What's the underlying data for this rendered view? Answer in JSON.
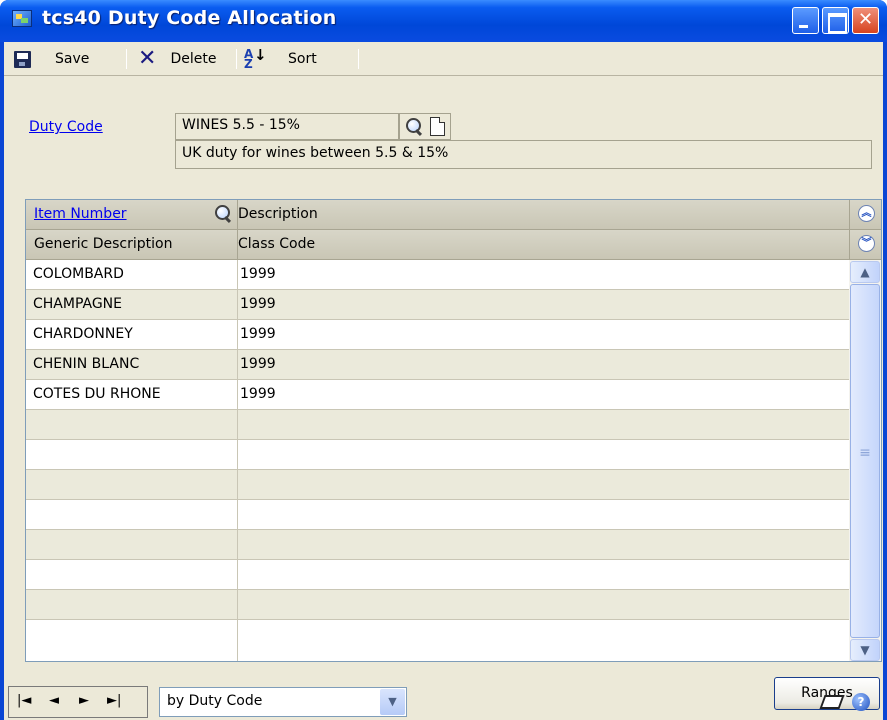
{
  "window": {
    "title": "tcs40 Duty Code Allocation",
    "accent_color": "#0a46d4"
  },
  "toolbar": {
    "save_label": "Save",
    "delete_label": "Delete",
    "sort_label": "Sort"
  },
  "duty": {
    "label": "Duty Code",
    "code_value": "WINES 5.5 - 15%",
    "description_value": "UK duty for wines between 5.5 & 15%"
  },
  "grid": {
    "header1": {
      "col1": "Item Number",
      "col2": "Description"
    },
    "header2": {
      "col1": "Generic Description",
      "col2": "Class Code"
    },
    "rows": [
      {
        "generic": "COLOMBARD",
        "class_code": "1999"
      },
      {
        "generic": "CHAMPAGNE",
        "class_code": "1999"
      },
      {
        "generic": "CHARDONNEY",
        "class_code": "1999"
      },
      {
        "generic": "CHENIN BLANC",
        "class_code": "1999"
      },
      {
        "generic": "COTES DU RHONE",
        "class_code": "1999"
      },
      {
        "generic": "",
        "class_code": ""
      },
      {
        "generic": "",
        "class_code": ""
      },
      {
        "generic": "",
        "class_code": ""
      },
      {
        "generic": "",
        "class_code": ""
      },
      {
        "generic": "",
        "class_code": ""
      },
      {
        "generic": "",
        "class_code": ""
      },
      {
        "generic": "",
        "class_code": ""
      },
      {
        "generic": "",
        "class_code": ""
      }
    ]
  },
  "buttons": {
    "ranges_label": "Ranges"
  },
  "status": {
    "sort_option": "by Duty Code"
  },
  "icons": {
    "save": "save-icon",
    "delete": "delete-icon",
    "sort": "sort-icon",
    "lookup": "lookup-icon",
    "new": "new-document-icon",
    "note": "note-icon",
    "help": "help-icon"
  }
}
